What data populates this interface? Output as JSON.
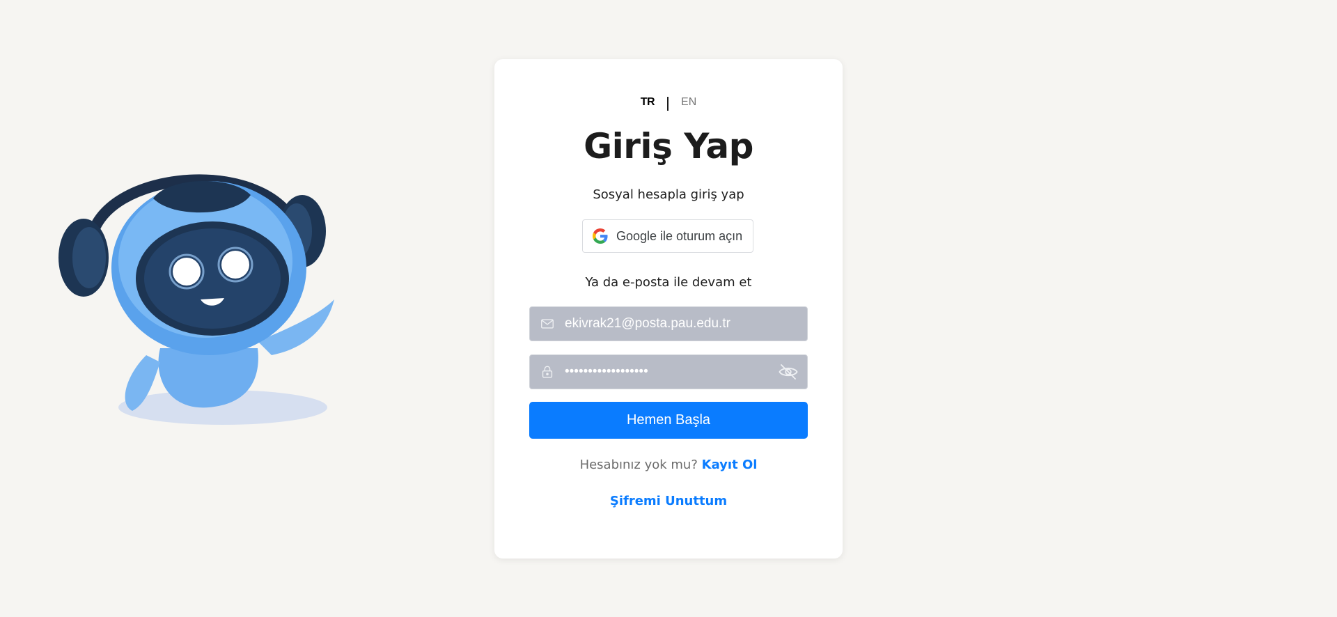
{
  "language": {
    "active": "TR",
    "other": "EN"
  },
  "login": {
    "title": "Giriş Yap",
    "social_prompt": "Sosyal hesapla giriş yap",
    "google_button_label": "Google ile oturum açın",
    "email_divider": "Ya da e-posta ile devam et",
    "email_value": "ekivrak21@posta.pau.edu.tr",
    "password_value": "••••••••••••••••••",
    "submit_label": "Hemen Başla",
    "no_account_text": "Hesabınız yok mu?",
    "signup_link": "Kayıt Ol",
    "forgot_password_link": "Şifremi Unuttum"
  },
  "icons": {
    "email_field_icon": "mail-icon",
    "password_field_icon": "lock-icon",
    "password_toggle_icon": "eye-off-icon",
    "google_icon": "google-logo-icon"
  },
  "colors": {
    "accent": "#0a7cff",
    "field_background": "#b8bcc7",
    "page_background": "#f6f5f2"
  }
}
